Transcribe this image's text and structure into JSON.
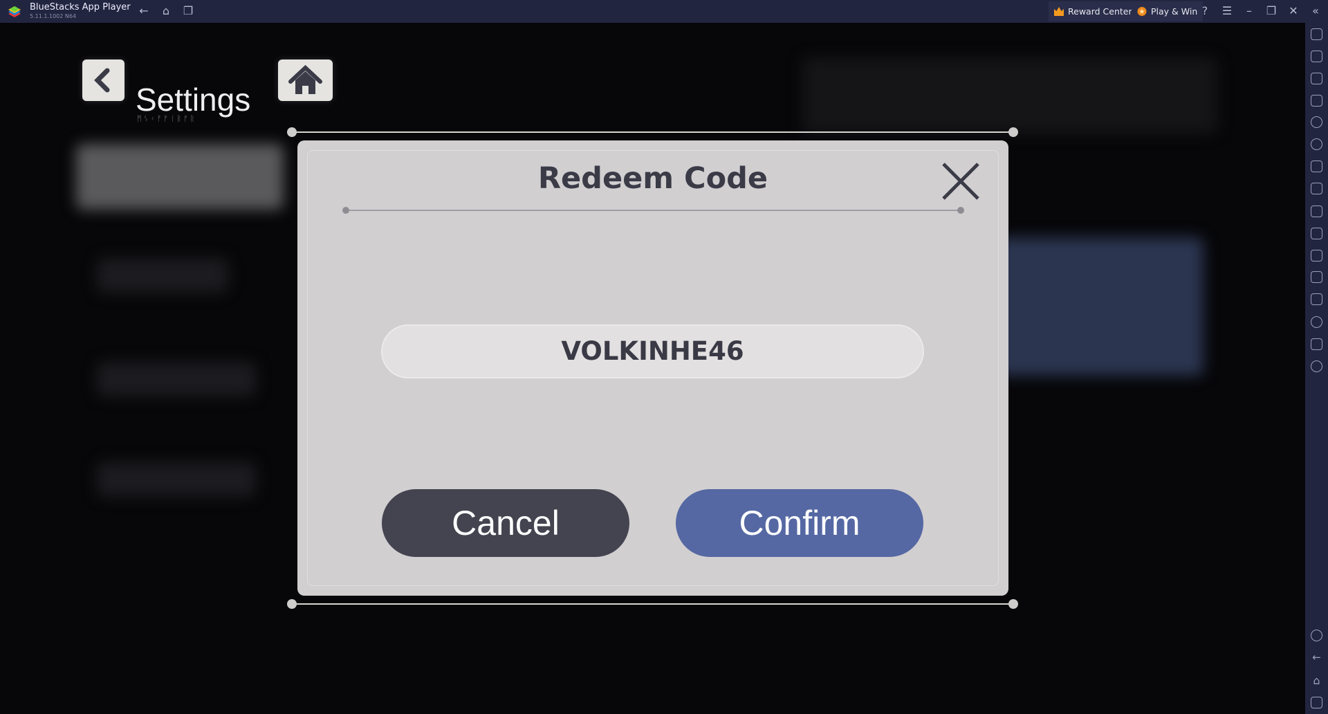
{
  "titlebar": {
    "app_name": "BlueStacks App Player",
    "version": "5.11.1.1002  N64",
    "reward_center": "Reward Center",
    "play_win": "Play & Win"
  },
  "game": {
    "header": {
      "title": "Settings",
      "subtitle": "ᛗᛊᚲᚠᚠᛁᛒᚠᚱ"
    },
    "dialog": {
      "title": "Redeem Code",
      "code_value": "VOLKINHE46",
      "cancel_label": "Cancel",
      "confirm_label": "Confirm"
    }
  },
  "colors": {
    "titlebar": "#22253f",
    "dialog_bg": "#d2cfd1",
    "cancel": "#43444f",
    "confirm": "#5568a3"
  }
}
